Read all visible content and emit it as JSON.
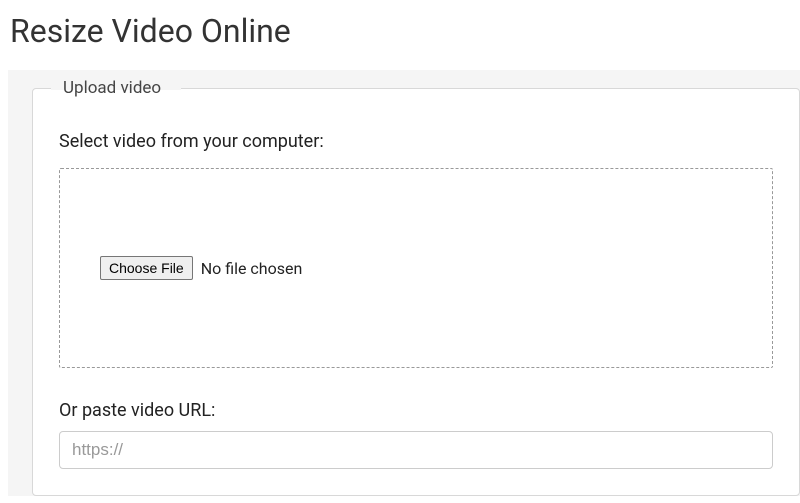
{
  "page": {
    "title": "Resize Video Online"
  },
  "upload": {
    "legend": "Upload video",
    "select_label": "Select video from your computer:",
    "choose_button": "Choose File",
    "file_status": "No file chosen",
    "url_label": "Or paste video URL:",
    "url_placeholder": "https://",
    "url_value": ""
  }
}
